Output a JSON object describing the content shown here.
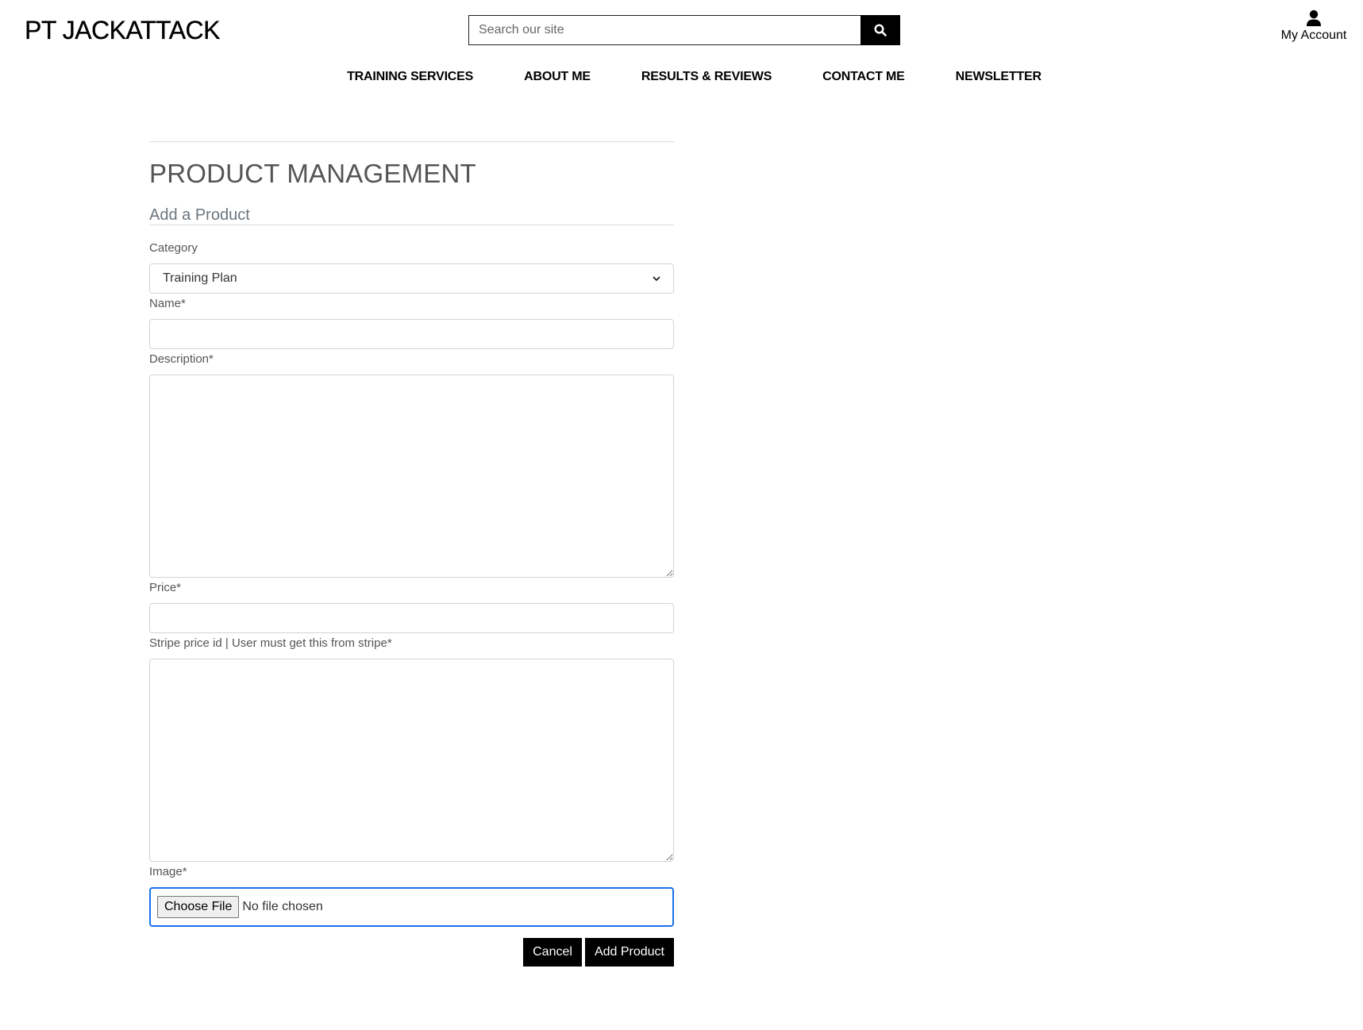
{
  "header": {
    "logo": "PT JACKATTACK",
    "search_placeholder": "Search our site",
    "account_label": "My Account"
  },
  "nav": {
    "items": [
      {
        "label": "TRAINING SERVICES"
      },
      {
        "label": "ABOUT ME"
      },
      {
        "label": "RESULTS & REVIEWS"
      },
      {
        "label": "CONTACT ME"
      },
      {
        "label": "NEWSLETTER"
      }
    ]
  },
  "page": {
    "title": "PRODUCT MANAGEMENT",
    "subtitle": "Add a Product"
  },
  "form": {
    "category_label": "Category",
    "category_value": "Training Plan",
    "name_label": "Name*",
    "name_value": "",
    "description_label": "Description*",
    "description_value": "",
    "price_label": "Price*",
    "price_value": "",
    "stripe_label": "Stripe price id | User must get this from stripe*",
    "stripe_value": "",
    "image_label": "Image*",
    "file_button": "Choose File",
    "file_status": "No file chosen",
    "cancel_label": "Cancel",
    "submit_label": "Add Product"
  }
}
